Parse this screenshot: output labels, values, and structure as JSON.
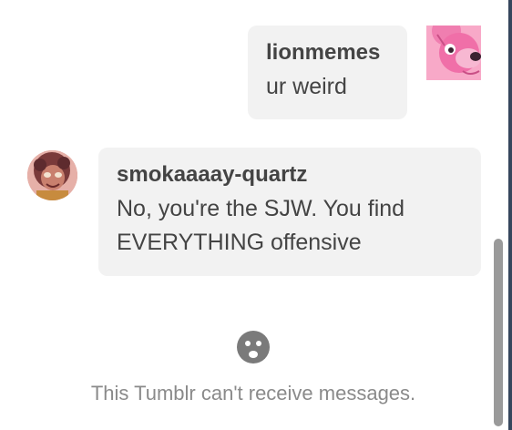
{
  "conversation": {
    "messages": [
      {
        "side": "right",
        "username": "lionmemes",
        "text": "ur weird",
        "avatar_icon": "pink-lion-avatar"
      },
      {
        "side": "left",
        "username": "smokaaaay-quartz",
        "text": "No, you're the SJW. You find EVERYTHING offensive",
        "avatar_icon": "smoky-quartz-avatar"
      }
    ]
  },
  "blocked_notice": {
    "icon": "sad-face-icon",
    "text": "This Tumblr can't receive messages."
  },
  "colors": {
    "bubble_bg": "#f2f2f2",
    "text": "#444444",
    "muted_text": "#8a8a8a",
    "scrollbar_thumb": "#9a9a9a",
    "scrollbar_edge": "#36465d"
  }
}
